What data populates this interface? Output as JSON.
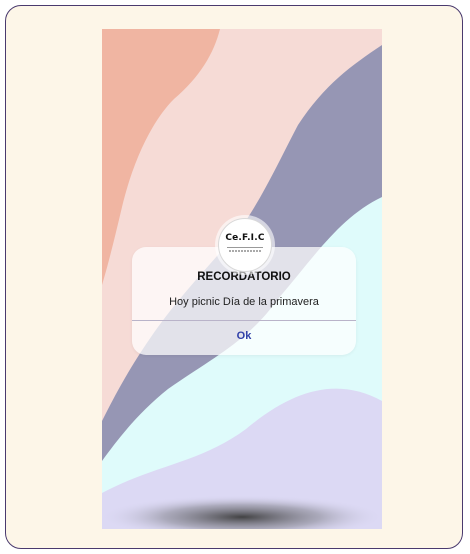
{
  "colors": {
    "frame_border": "#4a3a6e",
    "frame_background": "#fdf6e8",
    "wave_salmon": "#f0b5a2",
    "wave_light_pink": "#f6dbd6",
    "wave_slate": "#9696b4",
    "wave_cyan": "#dffbfb",
    "wave_lavender": "#dcd9f4",
    "ok_button_text": "#2f3fa8"
  },
  "logo": {
    "text": "Ce.F.I.C"
  },
  "dialog": {
    "title": "RECORDATORIO",
    "message": "Hoy picnic Día de la primavera",
    "ok_label": "Ok"
  }
}
